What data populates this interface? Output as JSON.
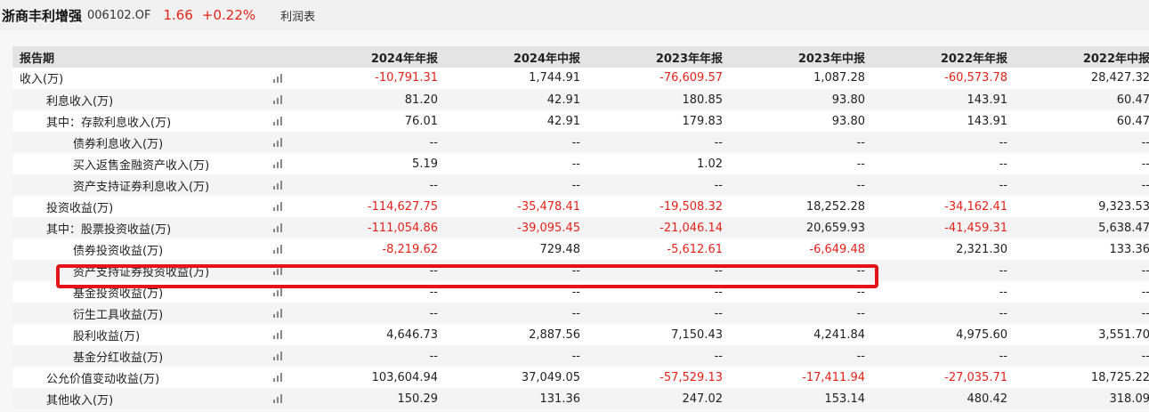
{
  "header": {
    "fund_name": "浙商丰利增强",
    "fund_code": "006102.OF",
    "price": "1.66",
    "change": "+0.22%",
    "tab_label": "利润表"
  },
  "table": {
    "label_header": "报告期",
    "periods": [
      "2024年年报",
      "2024年中报",
      "2023年年报",
      "2023年中报",
      "2022年年报",
      "2022年中报"
    ],
    "rows": [
      {
        "label": "收入(万)",
        "indent": 0,
        "values": [
          "-10,791.31",
          "1,744.91",
          "-76,609.57",
          "1,087.28",
          "-60,573.78",
          "28,427.32"
        ]
      },
      {
        "label": "利息收入(万)",
        "indent": 1,
        "values": [
          "81.20",
          "42.91",
          "180.85",
          "93.80",
          "143.91",
          "60.47"
        ]
      },
      {
        "label": "其中：存款利息收入(万)",
        "indent": 1,
        "values": [
          "76.01",
          "42.91",
          "179.83",
          "93.80",
          "143.91",
          "60.47"
        ]
      },
      {
        "label": "债券利息收入(万)",
        "indent": 2,
        "values": [
          "--",
          "--",
          "--",
          "--",
          "--",
          "--"
        ]
      },
      {
        "label": "买入返售金融资产收入(万)",
        "indent": 2,
        "values": [
          "5.19",
          "--",
          "1.02",
          "--",
          "--",
          "--"
        ]
      },
      {
        "label": "资产支持证券利息收入(万)",
        "indent": 2,
        "values": [
          "--",
          "--",
          "--",
          "--",
          "--",
          "--"
        ]
      },
      {
        "label": "投资收益(万)",
        "indent": 1,
        "values": [
          "-114,627.75",
          "-35,478.41",
          "-19,508.32",
          "18,252.28",
          "-34,162.41",
          "9,323.53"
        ]
      },
      {
        "label": "其中：股票投资收益(万)",
        "indent": 1,
        "values": [
          "-111,054.86",
          "-39,095.45",
          "-21,046.14",
          "20,659.93",
          "-41,459.31",
          "5,638.47"
        ]
      },
      {
        "label": "债券投资收益(万)",
        "indent": 2,
        "values": [
          "-8,219.62",
          "729.48",
          "-5,612.61",
          "-6,649.48",
          "2,321.30",
          "133.36"
        ]
      },
      {
        "label": "资产支持证券投资收益(万)",
        "indent": 2,
        "values": [
          "--",
          "--",
          "--",
          "--",
          "--",
          "--"
        ]
      },
      {
        "label": "基金投资收益(万)",
        "indent": 2,
        "values": [
          "--",
          "--",
          "--",
          "--",
          "--",
          "--"
        ]
      },
      {
        "label": "衍生工具收益(万)",
        "indent": 2,
        "values": [
          "--",
          "--",
          "--",
          "--",
          "--",
          "--"
        ]
      },
      {
        "label": "股利收益(万)",
        "indent": 2,
        "values": [
          "4,646.73",
          "2,887.56",
          "7,150.43",
          "4,241.84",
          "4,975.60",
          "3,551.70"
        ]
      },
      {
        "label": "基金分红收益(万)",
        "indent": 2,
        "values": [
          "--",
          "--",
          "--",
          "--",
          "--",
          "--"
        ]
      },
      {
        "label": "公允价值变动收益(万)",
        "indent": 1,
        "values": [
          "103,604.94",
          "37,049.05",
          "-57,529.13",
          "-17,411.94",
          "-27,035.71",
          "18,725.22"
        ]
      },
      {
        "label": "其他收入(万)",
        "indent": 1,
        "values": [
          "150.29",
          "131.36",
          "247.02",
          "153.14",
          "480.42",
          "318.09"
        ]
      }
    ]
  },
  "colors": {
    "negative": "#e2231a",
    "highlight_border": "#e5141b",
    "header_bg": "#e4e4e4",
    "topbar_bg": "#f1f1f1"
  },
  "icons": {
    "chart_icon": "bar-chart-icon"
  }
}
